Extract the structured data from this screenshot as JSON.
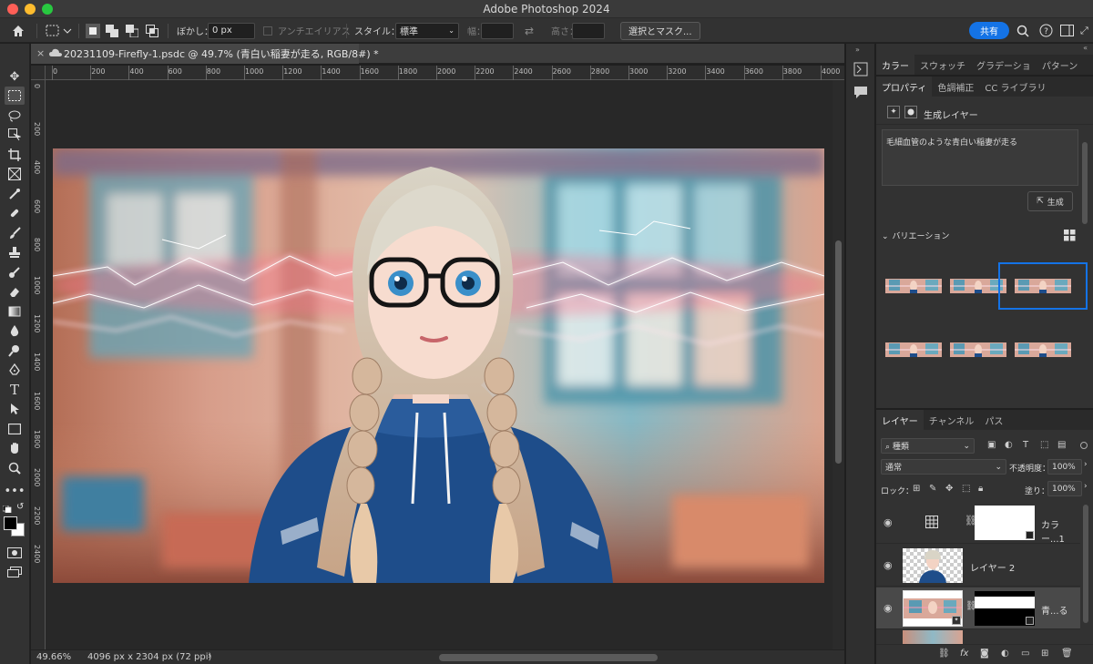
{
  "window": {
    "title": "Adobe Photoshop 2024"
  },
  "options": {
    "feather_label": "ぼかし：",
    "feather_value": "0 px",
    "antialias_label": "アンチエイリアス",
    "style_label": "スタイル：",
    "style_value": "標準",
    "width_label": "幅：",
    "height_label": "高さ：",
    "select_mask_label": "選択とマスク...",
    "share_label": "共有"
  },
  "document": {
    "tab_title": "20231109-Firefly-1.psdc @ 49.7% (青白い稲妻が走る, RGB/8#) *",
    "zoom": "49.66%",
    "size_info": "4096 px x 2304 px (72 ppi)"
  },
  "ruler": {
    "h_labels": [
      "0",
      "200",
      "400",
      "600",
      "800",
      "1000",
      "1200",
      "1400",
      "1600",
      "1800",
      "2000",
      "2200",
      "2400",
      "2600",
      "2800",
      "3000",
      "3200",
      "3400",
      "3600",
      "3800",
      "4000"
    ],
    "v_labels": [
      "0",
      "2 0 0",
      "4 0 0",
      "6 0 0",
      "8 0 0",
      "1 0 0 0",
      "1 2 0 0",
      "1 4 0 0",
      "1 6 0 0",
      "1 8 0 0",
      "2 0 0 0",
      "2 2 0 0",
      "2 4 0 0"
    ]
  },
  "top_panel": {
    "tabs": [
      "カラー",
      "スウォッチ",
      "グラデーショ",
      "パターン"
    ]
  },
  "properties": {
    "tabs": [
      "プロパティ",
      "色調補正",
      "CC ライブラリ"
    ],
    "layer_kind": "生成レイヤー",
    "prompt": "毛細血管のような青白い稲妻が走る",
    "generate_label": "生成",
    "variations_label": "バリエーション"
  },
  "layers": {
    "tabs": [
      "レイヤー",
      "チャンネル",
      "パス"
    ],
    "filter_kind": "種類",
    "blend_mode": "通常",
    "opacity_label": "不透明度：",
    "opacity_value": "100%",
    "lock_label": "ロック：",
    "fill_label": "塗り：",
    "fill_value": "100%",
    "items": [
      {
        "name": "カラー...1"
      },
      {
        "name": "レイヤー 2"
      },
      {
        "name": "青...る"
      }
    ]
  }
}
